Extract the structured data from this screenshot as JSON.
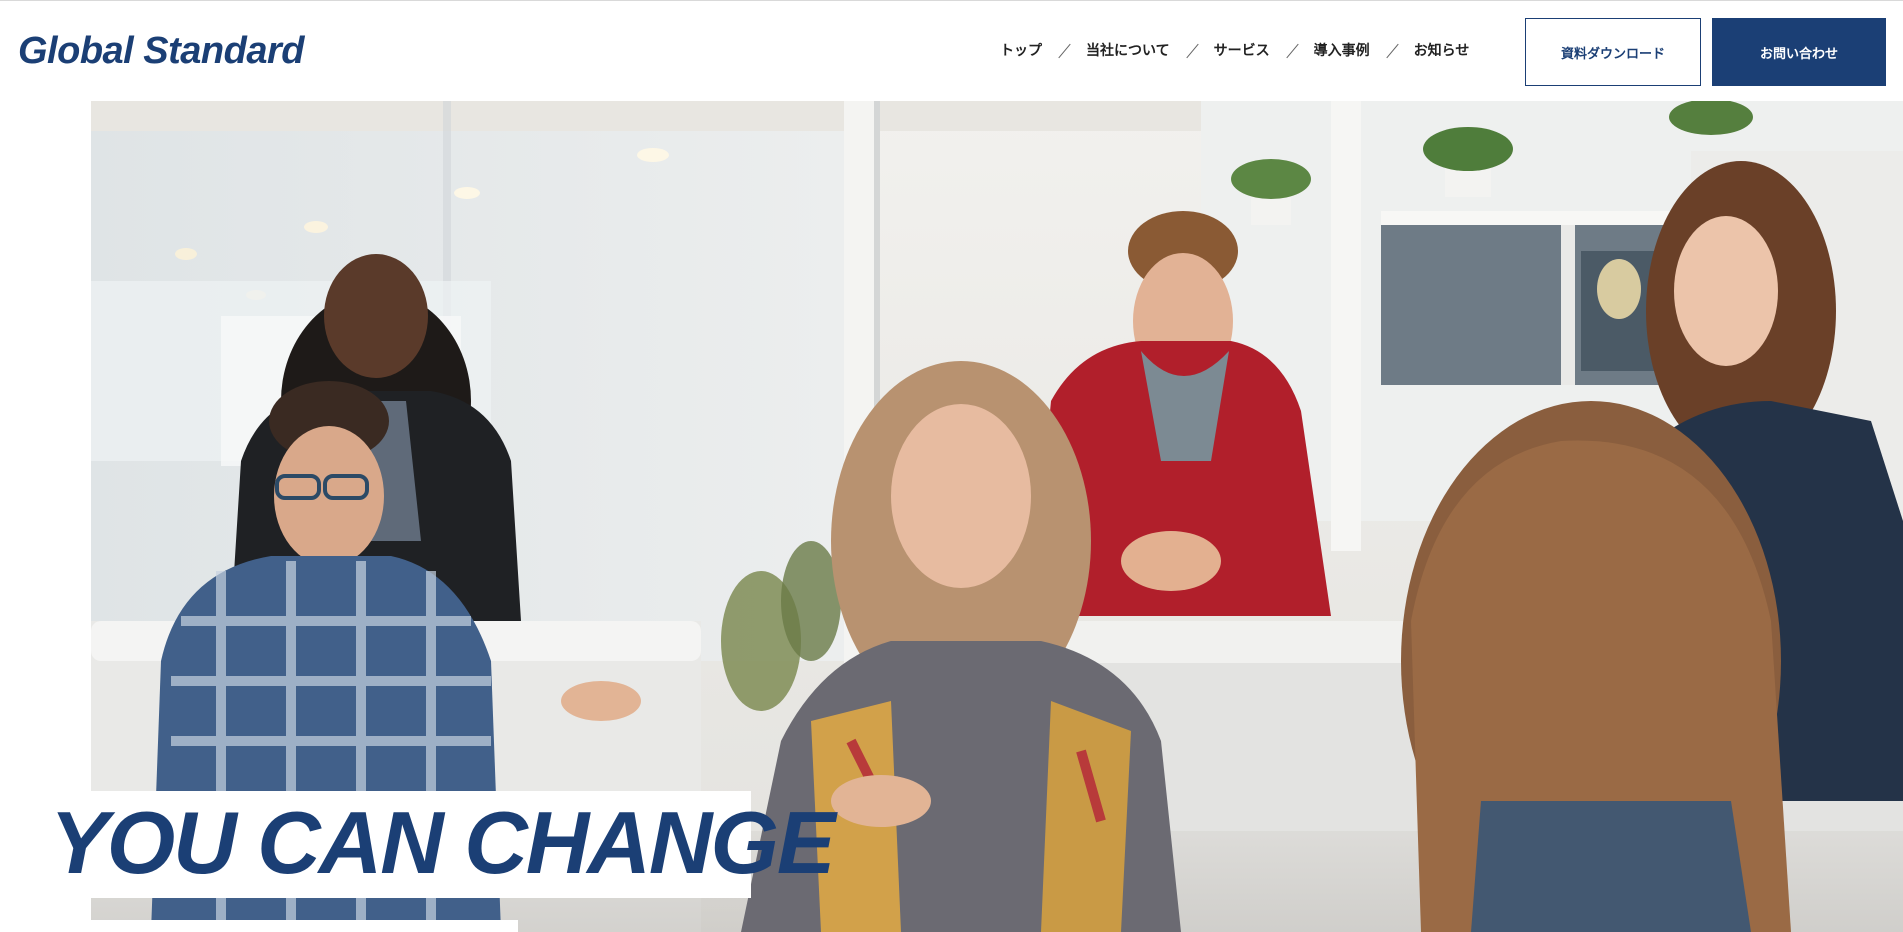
{
  "header": {
    "logo": "Global Standard",
    "nav": [
      {
        "label": "トップ"
      },
      {
        "label": "当社について"
      },
      {
        "label": "サービス"
      },
      {
        "label": "導入事例"
      },
      {
        "label": "お知らせ"
      }
    ],
    "download_button": "資料ダウンロード",
    "contact_button": "お問い合わせ"
  },
  "hero": {
    "image": "office-team-meeting-photo",
    "caption": "YOU CAN CHANGE"
  },
  "colors": {
    "brand": "#1b3f75",
    "background": "#ffffff"
  }
}
